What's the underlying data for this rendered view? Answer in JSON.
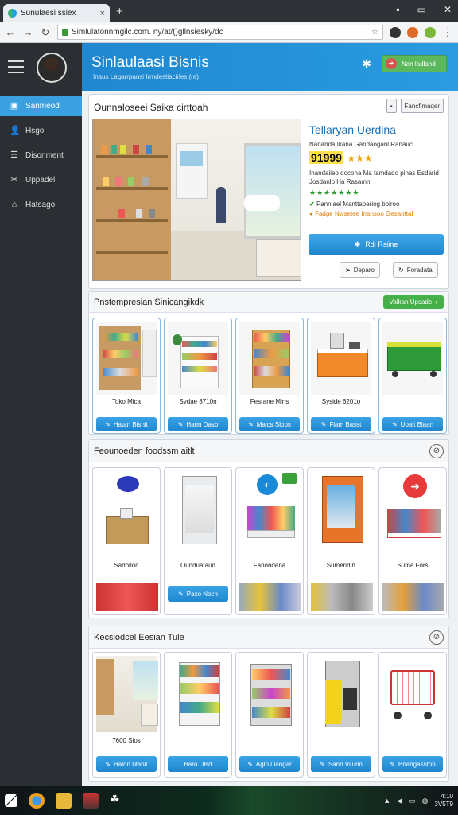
{
  "browser": {
    "tab_title": "Sunulaesi ssiex",
    "url": "Simlulatonnmgilc.com. ny/at/()gllnsiesky/dc"
  },
  "sidebar": {
    "items": [
      {
        "label": "Sanmeod",
        "icon": "monitor-icon"
      },
      {
        "label": "Hsgo",
        "icon": "user-icon"
      },
      {
        "label": "Disonment",
        "icon": "list-icon"
      },
      {
        "label": "Uppadel",
        "icon": "tools-icon"
      },
      {
        "label": "Hatsago",
        "icon": "bank-icon"
      }
    ]
  },
  "hero": {
    "title": "Sinlaulaasi Bisnis",
    "subtitle": "Inaus Lagarrpansi Irrndestiacirles (ra)",
    "button_label": "Nan ladland"
  },
  "featured": {
    "title": "Ounnaloseei Saika cirttoah",
    "btn_small": "",
    "btn_more": "Fancfimaqer",
    "product_name": "Tellaryan Uerdina",
    "desc1": "Nananda Ikana Gandaoganl Ranauc",
    "price": "91999",
    "stars": "★★★",
    "desc2": "Inandaiieo docona Ma famdado pinas Esdarid Josdanlo Ha Rasamn",
    "green_stars": "★★★★★★★",
    "ok_text": "Pannlael Manttaoeriog bolroo",
    "warn_text": "Fadge Nwsetee Inansoo Gesanttal",
    "main_button": "Rdi Rsiine",
    "btn_depo": "Deparo",
    "btn_fora": "Foradata"
  },
  "section2": {
    "title": "Pnstempresian Sinicangikdk",
    "action": "Valkan Upsade",
    "tiles": [
      {
        "label": "Toko Mica",
        "button": "Hatarl Bisnit"
      },
      {
        "label": "Sydae 8710n",
        "button": "Hann Dasb"
      },
      {
        "label": "Fesrane Mins",
        "button": "Malcs Slops"
      },
      {
        "label": "Syside 6201o",
        "button": "Fiam Basst"
      },
      {
        "label": "",
        "button": "Uoalt Blaan"
      }
    ]
  },
  "section3": {
    "title": "Feounoeden foodssm aitlt",
    "tiles": [
      {
        "label": "Sadollon",
        "button": ""
      },
      {
        "label": "Ounduataud",
        "button": "Paxo Noch"
      },
      {
        "label": "Fanondena",
        "button": ""
      },
      {
        "label": "Sumendirt",
        "button": ""
      },
      {
        "label": "Suma Fors",
        "button": ""
      }
    ]
  },
  "section4": {
    "title": "Kecsiodcel Eesian Tule",
    "tiles": [
      {
        "label": "7600 Sios",
        "button": "Halon Mank"
      },
      {
        "label": "",
        "button": "Baro Ulsd"
      },
      {
        "label": "",
        "button": "Aglo Llangar"
      },
      {
        "label": "",
        "button": "Sann Vilunn"
      },
      {
        "label": "",
        "button": "Bnangasston"
      }
    ]
  },
  "taskbar": {
    "time": "4:10",
    "date": "3V5T9"
  },
  "colors": {
    "accent": "#1f86cf",
    "green": "#45b048",
    "sidebar": "#2b2f33"
  }
}
